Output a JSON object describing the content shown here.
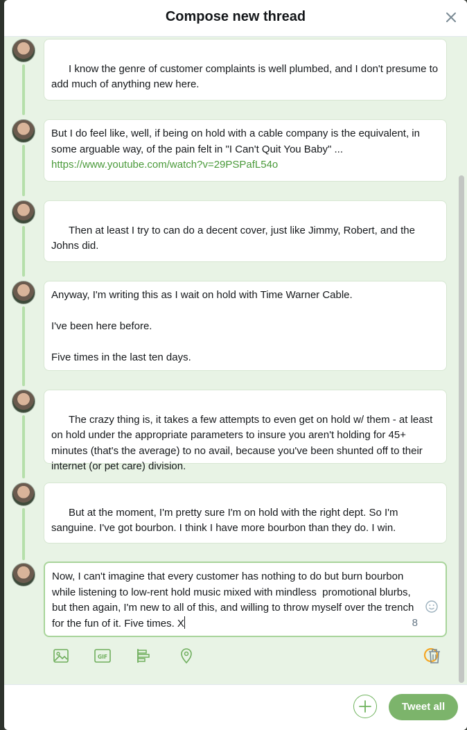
{
  "header": {
    "title": "Compose new thread",
    "close_icon": "close-icon"
  },
  "thread": [
    {
      "text": "I know the genre of customer complaints is well plumbed, and I don't presume to add much of anything new here."
    },
    {
      "text": "But I do feel like, well, if being on hold with a cable company is the equivalent, in some arguable way, of the pain felt in \"I Can't Quit You Baby\" ...",
      "link": "https://www.youtube.com/watch?v=29PSPafL54o"
    },
    {
      "text": "Then at least I try to can do a decent cover, just like Jimmy, Robert, and the Johns did."
    },
    {
      "text": "Anyway, I'm writing this as I wait on hold with Time Warner Cable.\n\nI've been here before.\n\nFive times in the last ten days."
    },
    {
      "text": "The crazy thing is, it takes a few attempts to even get on hold w/ them - at least on hold under the appropriate parameters to insure you aren't holding for 45+ minutes (that's the average) to no avail, because you've been shunted off to their internet (or pet care) division."
    },
    {
      "text": "But at the moment, I'm pretty sure I'm on hold with the right dept. So I'm sanguine. I've got bourbon. I think I have more bourbon than they do. I win."
    }
  ],
  "composer": {
    "text": "Now, I can't imagine that every customer has nothing to do but burn bourbon while listening to low-rent hold music mixed with mindless  promotional blurbs, but then again, I'm new to all of this, and willing to throw myself over the trench for the fun of it. Five times. X",
    "remaining_chars": "8"
  },
  "toolbar": {
    "icons": [
      "image-icon",
      "gif-icon",
      "poll-icon",
      "location-icon",
      "trash-icon"
    ]
  },
  "footer": {
    "tweet_all_label": "Tweet all",
    "add_icon": "plus-icon"
  },
  "colors": {
    "accent": "#7cb46b",
    "thread_bg": "#e8f3e5",
    "link": "#4a9a3a",
    "ring": "#f5a623"
  }
}
